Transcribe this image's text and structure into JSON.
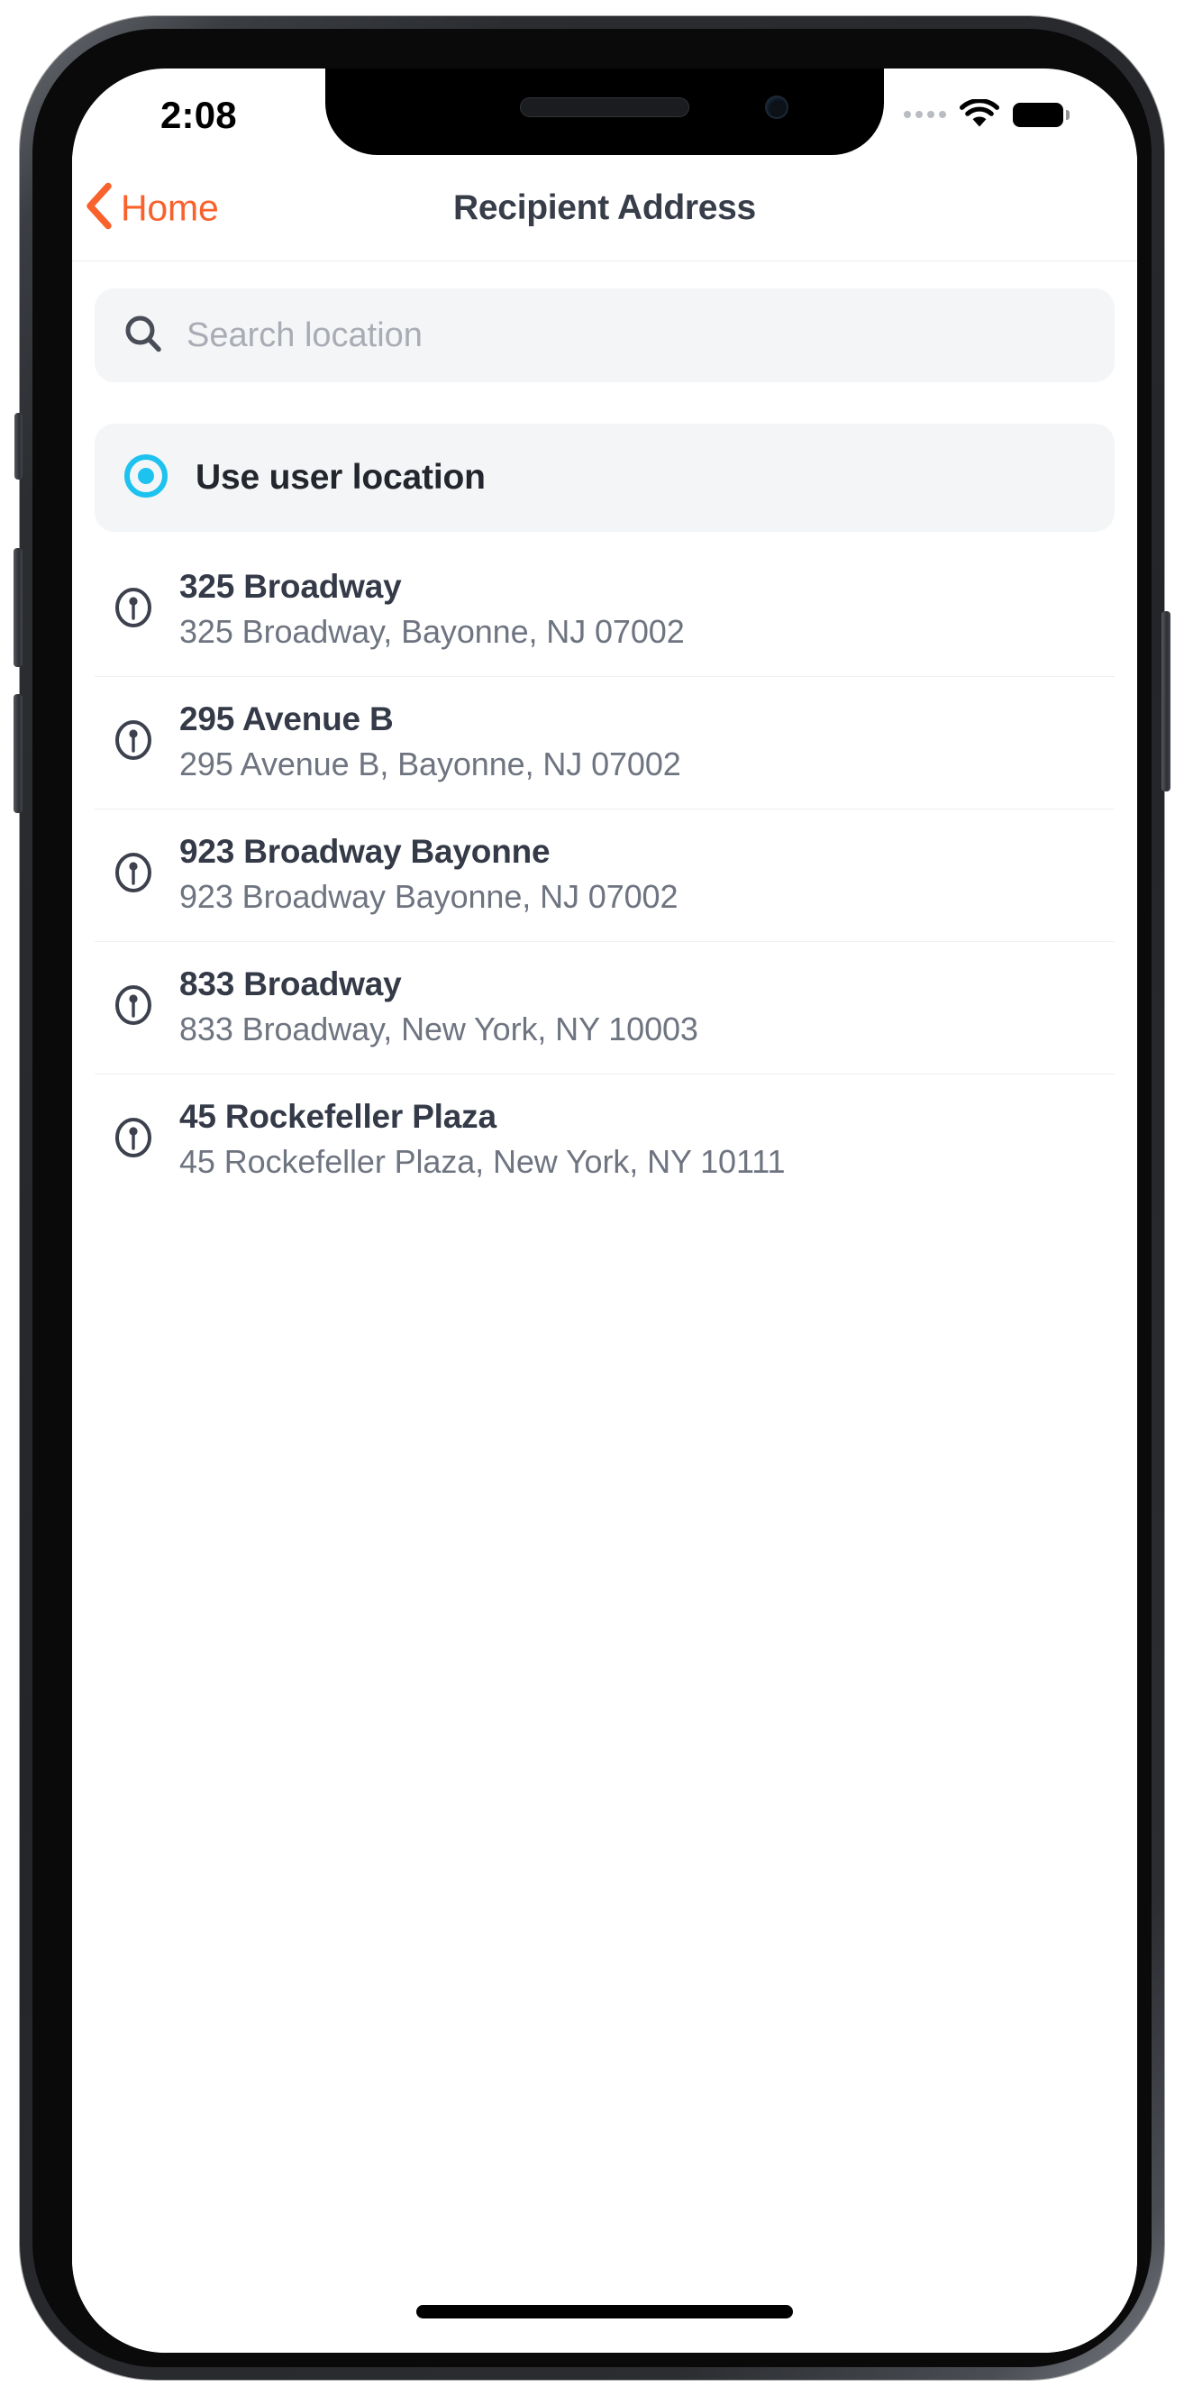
{
  "status_bar": {
    "time": "2:08",
    "signal_icon": "signal-dots-icon",
    "wifi_icon": "wifi-icon",
    "battery_icon": "battery-full-icon"
  },
  "nav_bar": {
    "back_icon": "chevron-left-icon",
    "back_label": "Home",
    "title": "Recipient Address",
    "back_color": "#f9622d",
    "title_color": "#373d49"
  },
  "search": {
    "icon": "search-icon",
    "placeholder": "Search location",
    "value": ""
  },
  "use_location": {
    "icon": "current-location-icon",
    "label": "Use user location",
    "accent_color": "#1ec2ee"
  },
  "address_list": {
    "row_icon": "map-pin-circle-icon",
    "rows": [
      {
        "title": "325 Broadway",
        "subtitle": "325 Broadway, Bayonne, NJ 07002"
      },
      {
        "title": "295 Avenue B",
        "subtitle": "295 Avenue B, Bayonne, NJ 07002"
      },
      {
        "title": "923 Broadway Bayonne",
        "subtitle": "923 Broadway Bayonne, NJ 07002"
      },
      {
        "title": "833 Broadway",
        "subtitle": "833 Broadway, New York, NY 10003"
      },
      {
        "title": "45 Rockefeller Plaza",
        "subtitle": "45 Rockefeller Plaza, New York, NY 10111"
      }
    ]
  }
}
